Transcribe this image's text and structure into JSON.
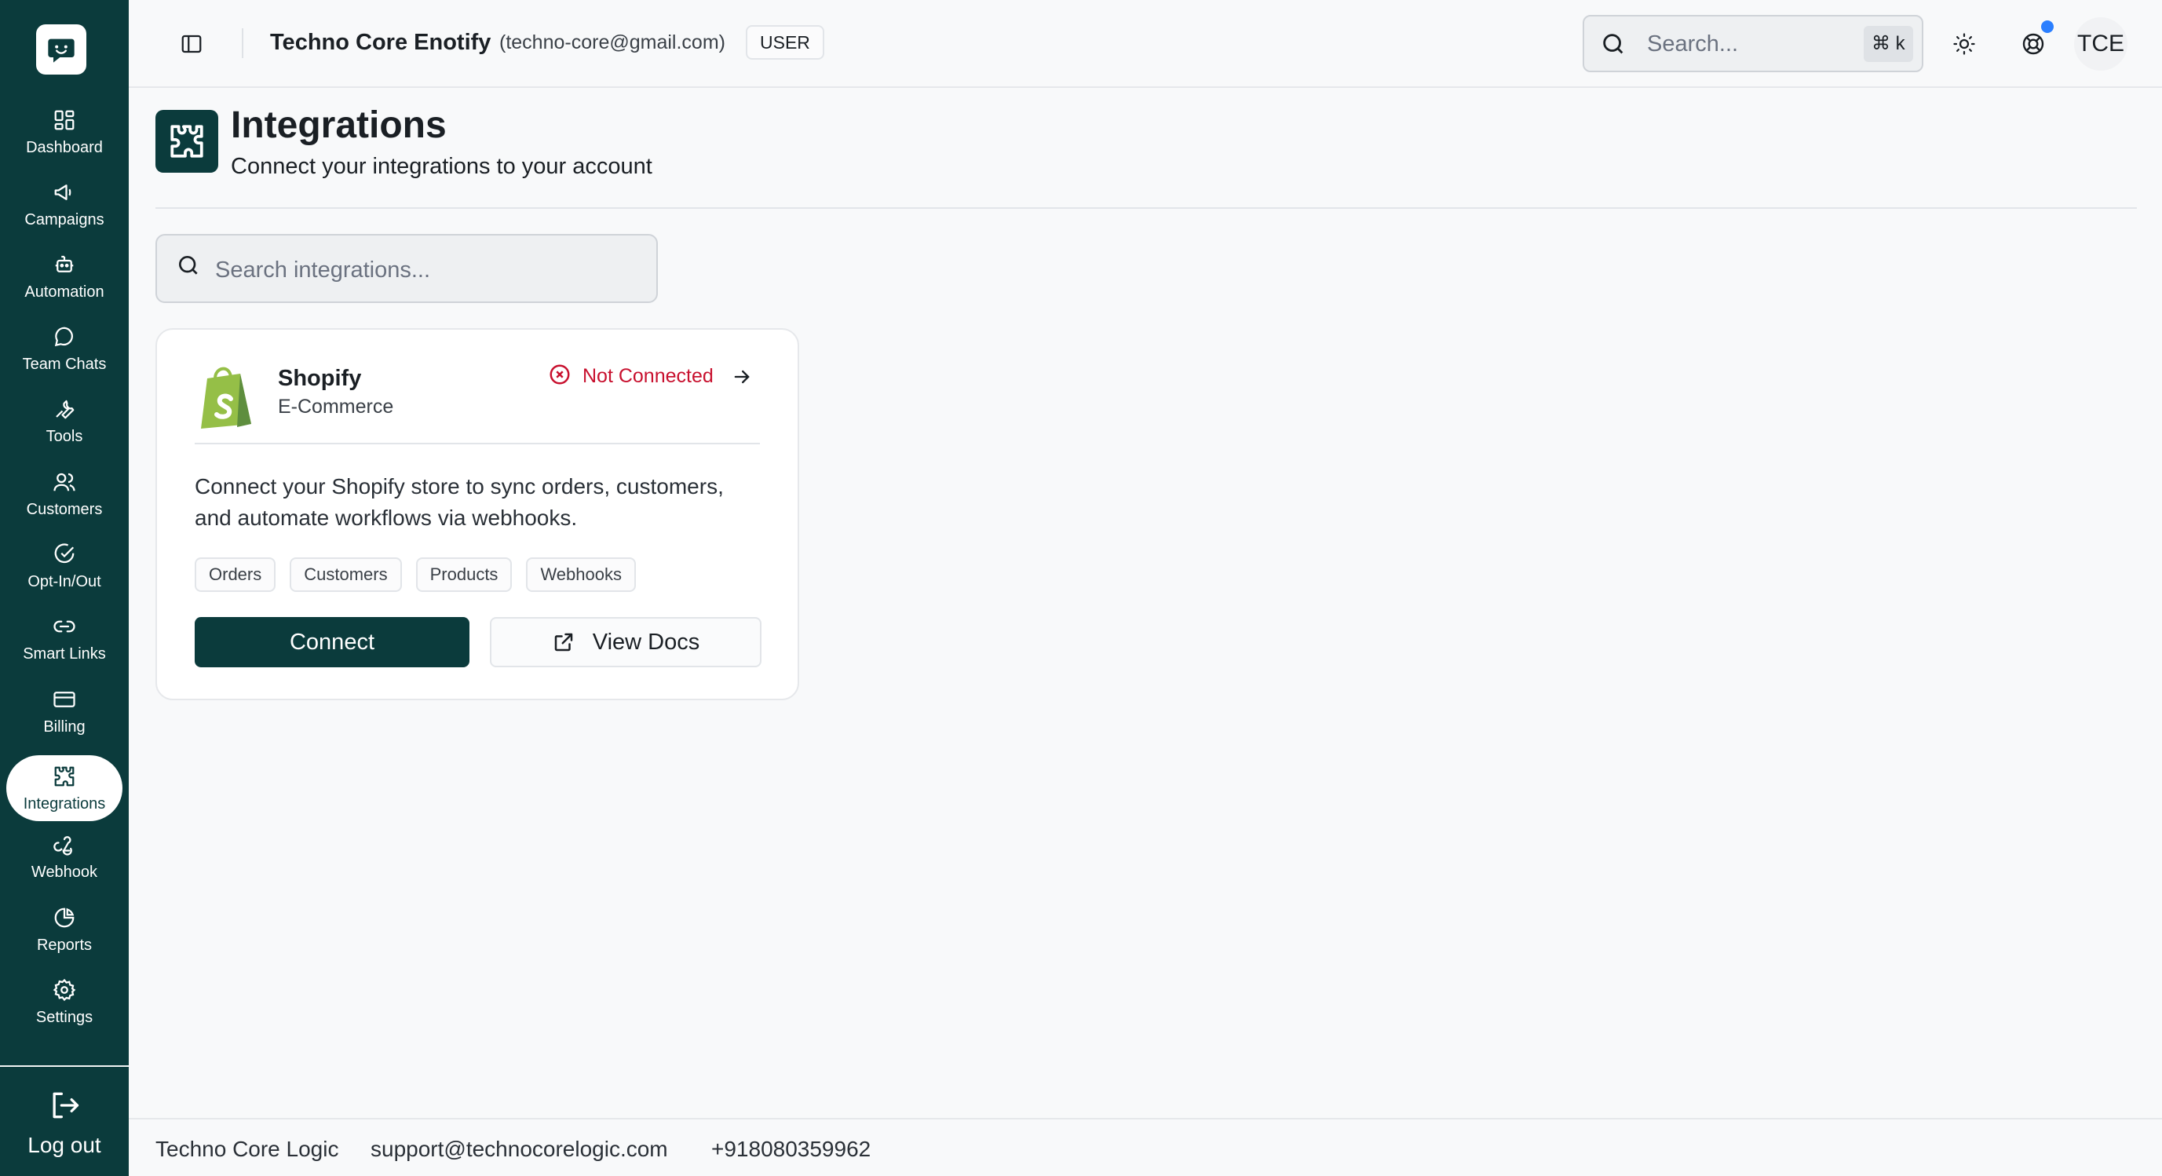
{
  "header": {
    "app_name": "Techno Core Enotify",
    "account_email": "(techno-core@gmail.com)",
    "role": "USER",
    "search_placeholder": "Search...",
    "shortcut": "⌘ k",
    "avatar_initials": "TCE",
    "notification_dot_color": "#2b7fff"
  },
  "sidebar": {
    "items": [
      {
        "label": "Dashboard",
        "icon": "grid-icon"
      },
      {
        "label": "Campaigns",
        "icon": "megaphone-icon"
      },
      {
        "label": "Automation",
        "icon": "bot-icon"
      },
      {
        "label": "Team Chats",
        "icon": "chat-icon"
      },
      {
        "label": "Tools",
        "icon": "wrench-icon"
      },
      {
        "label": "Customers",
        "icon": "users-icon"
      },
      {
        "label": "Opt-In/Out",
        "icon": "check-circle-icon"
      },
      {
        "label": "Smart Links",
        "icon": "link-icon"
      },
      {
        "label": "Billing",
        "icon": "credit-card-icon"
      },
      {
        "label": "Integrations",
        "icon": "puzzle-icon",
        "active": true
      },
      {
        "label": "Webhook",
        "icon": "webhook-icon"
      },
      {
        "label": "Reports",
        "icon": "pie-chart-icon"
      },
      {
        "label": "Settings",
        "icon": "gear-icon"
      }
    ],
    "logout_label": "Log out",
    "bg_color": "#0b3b3c"
  },
  "page": {
    "title": "Integrations",
    "subtitle": "Connect your integrations to your account",
    "search_placeholder": "Search integrations..."
  },
  "integration": {
    "name": "Shopify",
    "category": "E-Commerce",
    "status": "Not Connected",
    "status_color": "#c8102e",
    "description": "Connect your Shopify store to sync orders, customers, and automate workflows via webhooks.",
    "tags": [
      "Orders",
      "Customers",
      "Products",
      "Webhooks"
    ],
    "connect_label": "Connect",
    "docs_label": "View Docs"
  },
  "footer": {
    "company": "Techno Core Logic",
    "email": "support@technocorelogic.com",
    "phone": "+918080359962"
  }
}
